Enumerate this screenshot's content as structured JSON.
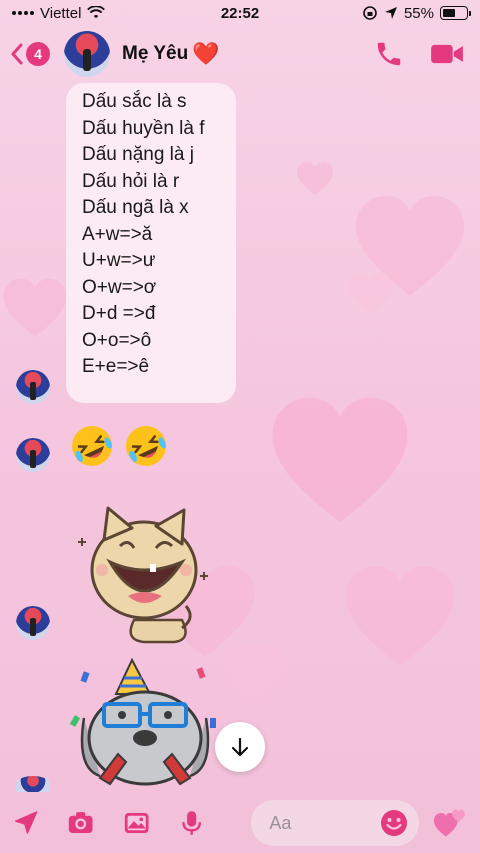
{
  "status_bar": {
    "carrier": "Viettel",
    "time": "22:52",
    "battery": "55%",
    "battery_level": 0.55
  },
  "header": {
    "back_badge": "4",
    "contact_name": "Mẹ Yêu",
    "name_emoji": "❤️",
    "icons": [
      "chevron-left-icon",
      "phone-icon",
      "video-camera-icon"
    ]
  },
  "messages": {
    "text_lines": [
      "Dấu sắc là s",
      "Dấu huyền là f",
      "Dấu nặng là j",
      "Dấu hỏi là r",
      "Dấu ngã là x",
      "A+w=>ă",
      "U+w=>ư",
      "O+w=>ơ",
      "D+d =>đ",
      "O+o=>ô",
      "E+e=>ê"
    ],
    "emoji_message": [
      "🤣",
      "🤣"
    ],
    "stickers": [
      "laughing-cat-sticker",
      "birthday-dog-sticker"
    ]
  },
  "composer": {
    "placeholder": "Aa",
    "icons": [
      "send-location-icon",
      "camera-icon",
      "image-icon",
      "microphone-icon",
      "emoji-icon",
      "hearts-icon"
    ]
  },
  "colors": {
    "accent": "#e5397f",
    "background": "#f5c6de",
    "bubble": "#fcebf3"
  }
}
